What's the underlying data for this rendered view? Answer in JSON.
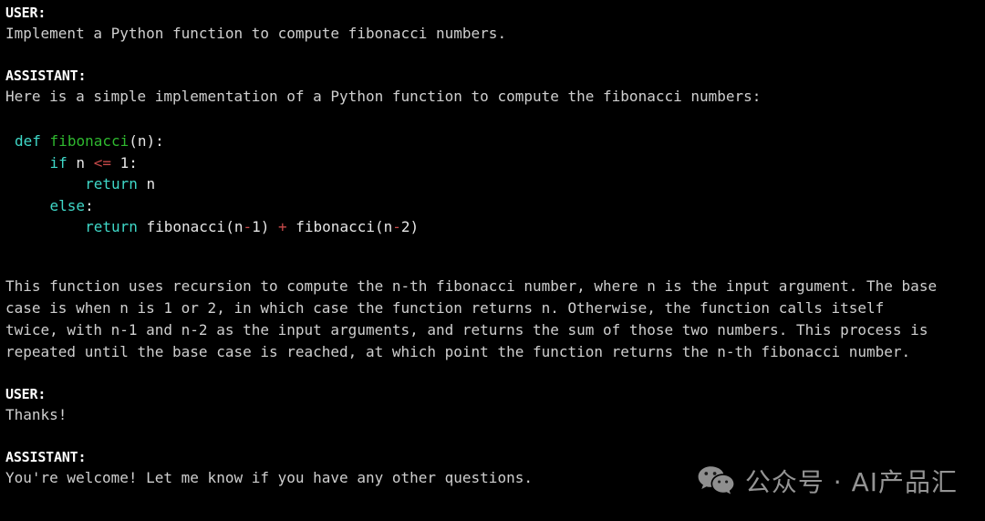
{
  "theme": {
    "background": "#000000",
    "body_text": "#cfcfcf",
    "label_text": "#ffffff",
    "code_keyword": "#3fd8c8",
    "code_function": "#2fb82f",
    "code_operator": "#c74a4a",
    "code_plain": "#e6e6e6",
    "watermark_text": "#949494"
  },
  "transcript": {
    "turns": [
      {
        "role_label": "USER:",
        "body": "Implement a Python function to compute fibonacci numbers."
      },
      {
        "role_label": "ASSISTANT:",
        "body": "Here is a simple implementation of a Python function to compute the fibonacci numbers:",
        "code": {
          "language": "python",
          "lines": [
            [
              {
                "t": "def",
                "c": "kw"
              },
              {
                "t": " ",
                "c": "plain"
              },
              {
                "t": "fibonacci",
                "c": "fn"
              },
              {
                "t": "(n):",
                "c": "plain"
              }
            ],
            [
              {
                "t": "    ",
                "c": "plain"
              },
              {
                "t": "if",
                "c": "kw"
              },
              {
                "t": " n ",
                "c": "plain"
              },
              {
                "t": "<=",
                "c": "op"
              },
              {
                "t": " 1:",
                "c": "plain"
              }
            ],
            [
              {
                "t": "        ",
                "c": "plain"
              },
              {
                "t": "return",
                "c": "kw"
              },
              {
                "t": " n",
                "c": "plain"
              }
            ],
            [
              {
                "t": "    ",
                "c": "plain"
              },
              {
                "t": "else",
                "c": "kw"
              },
              {
                "t": ":",
                "c": "plain"
              }
            ],
            [
              {
                "t": "        ",
                "c": "plain"
              },
              {
                "t": "return",
                "c": "kw"
              },
              {
                "t": " fibonacci(n",
                "c": "plain"
              },
              {
                "t": "-",
                "c": "op"
              },
              {
                "t": "1) ",
                "c": "plain"
              },
              {
                "t": "+",
                "c": "op"
              },
              {
                "t": " fibonacci(n",
                "c": "plain"
              },
              {
                "t": "-",
                "c": "op"
              },
              {
                "t": "2)",
                "c": "plain"
              }
            ]
          ],
          "plain_text": "def fibonacci(n):\n    if n <= 1:\n        return n\n    else:\n        return fibonacci(n-1) + fibonacci(n-2)"
        },
        "explanation": "This function uses recursion to compute the n-th fibonacci number, where n is the input argument. The base\ncase is when n is 1 or 2, in which case the function returns n. Otherwise, the function calls itself\ntwice, with n-1 and n-2 as the input arguments, and returns the sum of those two numbers. This process is\nrepeated until the base case is reached, at which point the function returns the n-th fibonacci number."
      },
      {
        "role_label": "USER:",
        "body": "Thanks!"
      },
      {
        "role_label": "ASSISTANT:",
        "body": "You're welcome! Let me know if you have any other questions."
      }
    ]
  },
  "watermark": {
    "icon": "wechat-icon",
    "text": "公众号 · AI产品汇"
  }
}
